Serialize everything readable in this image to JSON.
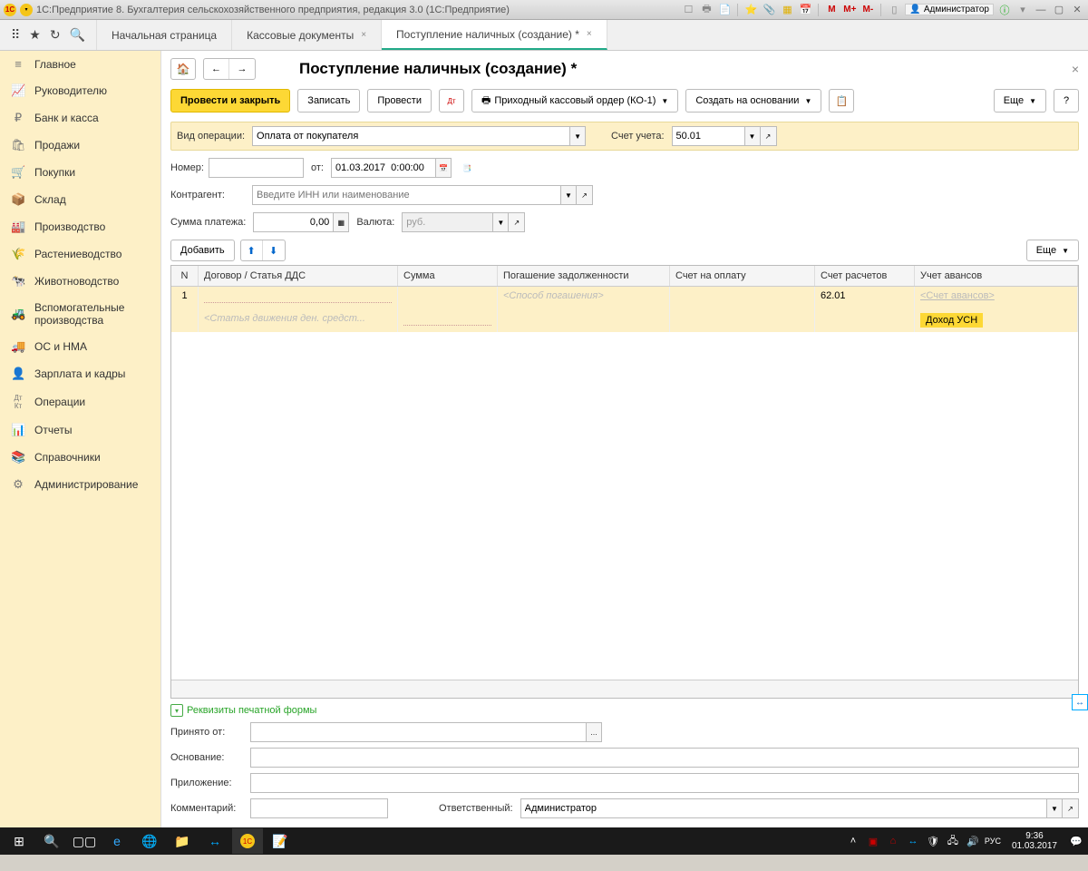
{
  "titlebar": {
    "title": "1С:Предприятие 8. Бухгалтерия сельскохозяйственного предприятия, редакция 3.0  (1С:Предприятие)",
    "user": "Администратор",
    "m_buttons": [
      "M",
      "M+",
      "M-"
    ]
  },
  "tabs": {
    "home": "Начальная страница",
    "cash": "Кассовые документы",
    "current": "Поступление наличных (создание) *"
  },
  "sidebar": [
    {
      "icon": "≡",
      "label": "Главное"
    },
    {
      "icon": "📈",
      "label": "Руководителю"
    },
    {
      "icon": "₽",
      "label": "Банк и касса"
    },
    {
      "icon": "🛍",
      "label": "Продажи"
    },
    {
      "icon": "🛒",
      "label": "Покупки"
    },
    {
      "icon": "🏢",
      "label": "Склад"
    },
    {
      "icon": "🏭",
      "label": "Производство"
    },
    {
      "icon": "🌾",
      "label": "Растениеводство"
    },
    {
      "icon": "🐄",
      "label": "Животноводство"
    },
    {
      "icon": "🚜",
      "label": "Вспомогательные производства"
    },
    {
      "icon": "🚚",
      "label": "ОС и НМА"
    },
    {
      "icon": "👤",
      "label": "Зарплата и кадры"
    },
    {
      "icon": "Дт/Кт",
      "label": "Операции"
    },
    {
      "icon": "📊",
      "label": "Отчеты"
    },
    {
      "icon": "📚",
      "label": "Справочники"
    },
    {
      "icon": "⚙",
      "label": "Администрирование"
    }
  ],
  "page": {
    "title": "Поступление наличных (создание) *"
  },
  "toolbar": {
    "post_close": "Провести и закрыть",
    "write": "Записать",
    "post": "Провести",
    "pko": "Приходный кассовый ордер (КО-1)",
    "create_based": "Создать на основании",
    "more": "Еще"
  },
  "form": {
    "op_type_label": "Вид операции:",
    "op_type_value": "Оплата от покупателя",
    "account_label": "Счет учета:",
    "account_value": "50.01",
    "number_label": "Номер:",
    "from_label": "от:",
    "date_value": "01.03.2017  0:00:00",
    "counterparty_label": "Контрагент:",
    "counterparty_placeholder": "Введите ИНН или наименование",
    "sum_label": "Сумма платежа:",
    "sum_value": "0,00",
    "currency_label": "Валюта:",
    "currency_value": "руб."
  },
  "table": {
    "add": "Добавить",
    "more": "Еще",
    "headers": {
      "n": "N",
      "contract": "Договор / Статья ДДС",
      "sum": "Сумма",
      "repay": "Погашение задолженности",
      "invoice": "Счет на оплату",
      "settle": "Счет расчетов",
      "advance": "Учет авансов"
    },
    "row": {
      "n": "1",
      "dds_ph": "<Статья движения ден. средст...",
      "repay_ph": "<Способ погашения>",
      "settle": "62.01",
      "adv_ph": "<Счет авансов>",
      "adv_badge": "Доход УСН"
    }
  },
  "expand": {
    "label": "Реквизиты печатной формы"
  },
  "bottom": {
    "received_from": "Принято от:",
    "basis": "Основание:",
    "attachment": "Приложение:",
    "comment": "Комментарий:",
    "responsible": "Ответственный:",
    "responsible_value": "Администратор"
  },
  "taskbar": {
    "time": "9:36",
    "date": "01.03.2017",
    "lang": "РУС"
  }
}
